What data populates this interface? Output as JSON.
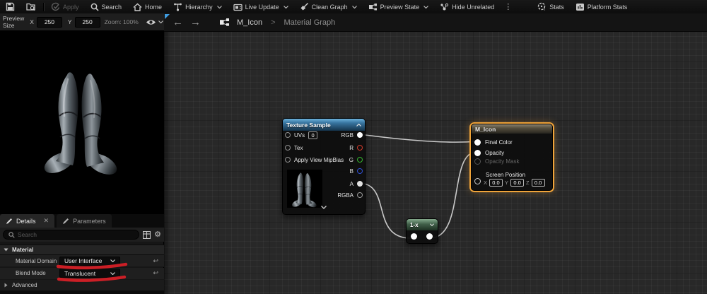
{
  "toolbar": {
    "items": [
      {
        "label": "Apply"
      },
      {
        "label": "Search"
      },
      {
        "label": "Home"
      },
      {
        "label": "Hierarchy"
      },
      {
        "label": "Live Update"
      },
      {
        "label": "Clean Graph"
      },
      {
        "label": "Preview State"
      },
      {
        "label": "Hide Unrelated"
      },
      {
        "label": "Stats"
      },
      {
        "label": "Platform Stats"
      }
    ]
  },
  "preview_bar": {
    "title": "Preview Size",
    "x_label": "X",
    "x_value": "250",
    "y_label": "Y",
    "y_value": "250",
    "zoom": "Zoom: 100%"
  },
  "breadcrumb": {
    "asset": "M_Icon",
    "sep": ">",
    "view": "Material Graph"
  },
  "graph": {
    "texture_sample": {
      "title": "Texture Sample",
      "inputs": [
        {
          "label": "UVs",
          "value": "0"
        },
        {
          "label": "Tex"
        },
        {
          "label": "Apply View MipBias"
        }
      ],
      "outputs": [
        {
          "label": "RGB"
        },
        {
          "label": "R"
        },
        {
          "label": "G"
        },
        {
          "label": "B"
        },
        {
          "label": "A"
        },
        {
          "label": "RGBA"
        }
      ]
    },
    "one_minus": {
      "title": "1-x"
    },
    "m_icon": {
      "title": "M_Icon",
      "pins": [
        {
          "label": "Final Color"
        },
        {
          "label": "Opacity"
        },
        {
          "label": "Opacity Mask"
        }
      ],
      "screen_position": {
        "label": "Screen Position",
        "fields": [
          {
            "label": "X",
            "value": "0.0"
          },
          {
            "label": "Y",
            "value": "0.0"
          },
          {
            "label": "Z",
            "value": "0.0"
          }
        ]
      }
    }
  },
  "details": {
    "tab_details": "Details",
    "tab_parameters": "Parameters",
    "search_placeholder": "Search",
    "category": "Material",
    "rows": [
      {
        "label": "Material Domain",
        "value": "User Interface"
      },
      {
        "label": "Blend Mode",
        "value": "Translucent"
      }
    ],
    "advanced": "Advanced"
  },
  "colors": {
    "selection_outline": "#F0A43A",
    "annotation_red": "#D91F27",
    "texture_header_blue": "#38749F",
    "function_header_green": "#41604A",
    "wire": "#C9C9C9"
  }
}
